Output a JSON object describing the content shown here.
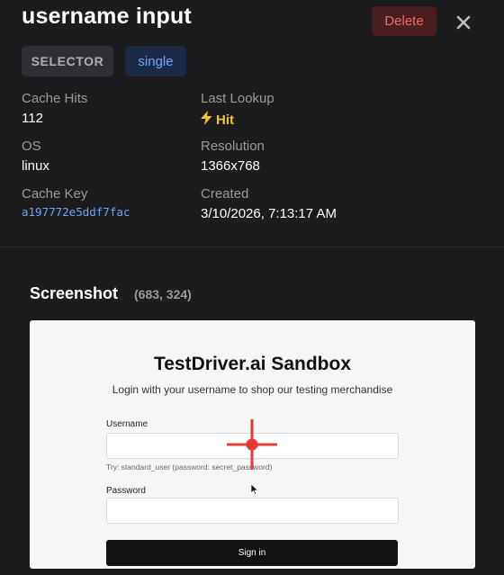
{
  "header": {
    "title": "username input",
    "delete_label": "Delete",
    "close_icon": "close-icon"
  },
  "badges": {
    "type": "SELECTOR",
    "mode": "single"
  },
  "meta": {
    "cache_hits_label": "Cache Hits",
    "cache_hits_value": "112",
    "last_lookup_label": "Last Lookup",
    "last_lookup_value": "Hit",
    "last_lookup_icon": "lightning-icon",
    "os_label": "OS",
    "os_value": "linux",
    "resolution_label": "Resolution",
    "resolution_value": "1366x768",
    "cache_key_label": "Cache Key",
    "cache_key_value": "a197772e5ddf7fac",
    "created_label": "Created",
    "created_value": "3/10/2026, 7:13:17 AM"
  },
  "screenshot": {
    "heading": "Screenshot",
    "coords": "(683, 324)",
    "sandbox": {
      "title": "TestDriver.ai Sandbox",
      "subtitle": "Login with your username to shop our testing merchandise",
      "username_label": "Username",
      "hint": "Try: standard_user (password: secret_password)",
      "password_label": "Password",
      "sign_in_label": "Sign in"
    }
  },
  "colors": {
    "background": "#1c1c1e",
    "delete": "#ef6b6b",
    "accent_blue": "#6ea4ff",
    "hit": "#f7c52b",
    "crosshair": "#e53935"
  }
}
